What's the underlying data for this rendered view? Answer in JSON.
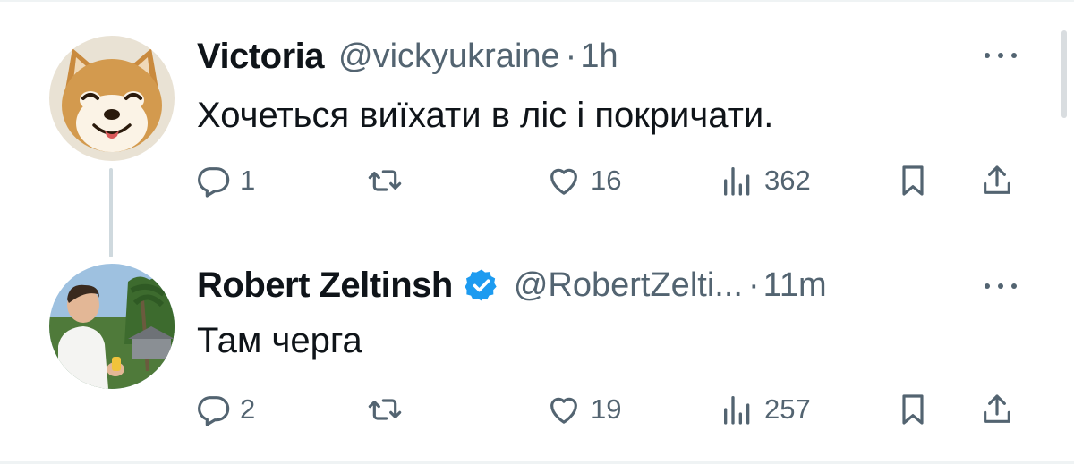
{
  "tweets": [
    {
      "author": {
        "name": "Victoria",
        "handle": "@vickyukraine",
        "verified": false,
        "avatar_icon": "shiba-dog-avatar"
      },
      "separator": "·",
      "time": "1h",
      "text": "Хочеться виїхати в ліс і покричати.",
      "stats": {
        "replies": "1",
        "reposts": "",
        "likes": "16",
        "views": "362"
      }
    },
    {
      "author": {
        "name": "Robert Zeltinsh",
        "handle": "@RobertZelti...",
        "verified": true,
        "verified_color": "#1d9bf0",
        "avatar_icon": "person-photo-avatar"
      },
      "separator": "·",
      "time": "11m",
      "text": "Там черга",
      "stats": {
        "replies": "2",
        "reposts": "",
        "likes": "19",
        "views": "257"
      }
    }
  ],
  "colors": {
    "text": "#0f1419",
    "secondary": "#536471",
    "thread_line": "#cfd9de",
    "verified": "#1d9bf0"
  },
  "icons": [
    "reply-icon",
    "repost-icon",
    "like-icon",
    "views-icon",
    "bookmark-icon",
    "share-icon",
    "more-icon"
  ]
}
